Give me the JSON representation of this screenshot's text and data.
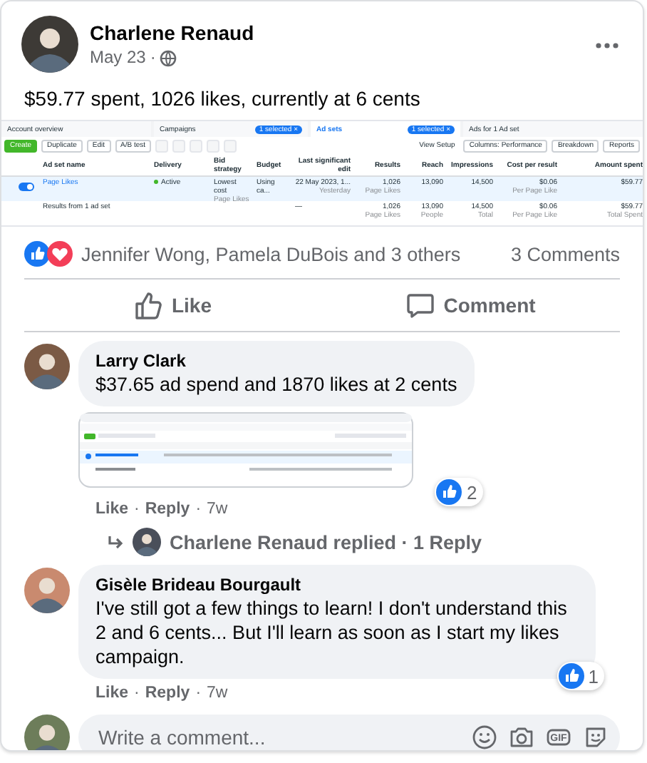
{
  "post": {
    "author": "Charlene Renaud",
    "date": "May 23",
    "separator": "·",
    "text": "$59.77 spent, 1026 likes, currently at 6 cents"
  },
  "ads_screenshot": {
    "tabs": [
      {
        "label": "Account overview",
        "selected": false
      },
      {
        "label": "Campaigns",
        "selected": false,
        "badge": "1 selected ×"
      },
      {
        "label": "Ad sets",
        "selected": true,
        "badge": "1 selected ×"
      },
      {
        "label": "Ads for 1 Ad set",
        "selected": false
      }
    ],
    "toolbar_left": [
      "Create",
      "Duplicate",
      "Edit",
      "A/B test"
    ],
    "toolbar_right": [
      "View Setup",
      "Columns: Performance",
      "Breakdown",
      "Reports"
    ],
    "columns": [
      "Ad set name",
      "Delivery",
      "Bid strategy",
      "Budget",
      "Last significant edit",
      "Results",
      "Reach",
      "Impressions",
      "Cost per result",
      "Amount spent"
    ],
    "rows": [
      {
        "on": true,
        "cells": [
          {
            "text": "Page Likes"
          },
          {
            "text": "Active"
          },
          {
            "text": "Lowest cost",
            "sub": "Page Likes"
          },
          {
            "text": "Using ca..."
          },
          {
            "text": "22 May 2023, 1...",
            "sub": "Yesterday"
          },
          {
            "text": "1,026",
            "sub": "Page Likes"
          },
          {
            "text": "13,090"
          },
          {
            "text": "14,500"
          },
          {
            "text": "$0.06",
            "sub": "Per Page Like"
          },
          {
            "text": "$59.77"
          }
        ]
      }
    ],
    "summary": {
      "label": "Results from 1 ad set",
      "cells": [
        {
          "text": "—"
        },
        {
          "text": "1,026",
          "sub": "Page Likes"
        },
        {
          "text": "13,090",
          "sub": "People"
        },
        {
          "text": "14,500",
          "sub": "Total"
        },
        {
          "text": "$0.06",
          "sub": "Per Page Like"
        },
        {
          "text": "$59.77",
          "sub": "Total Spent"
        }
      ]
    }
  },
  "reactions": {
    "names": "Jennifer Wong, Pamela DuBois and 3 others",
    "comments": "3 Comments"
  },
  "actions": [
    "Like",
    "Comment"
  ],
  "comments": [
    {
      "author": "Larry Clark",
      "text": "$37.65 ad spend and 1870 likes at 2 cents",
      "attachment": {
        "kind": "screenshot"
      },
      "likes": "2",
      "links": [
        "Like",
        "Reply"
      ],
      "time": "7w",
      "replies": "Charlene Renaud replied · 1 Reply"
    },
    {
      "author": "Gisèle Brideau Bourgault",
      "text": "I've still got a few things to learn! I don't understand this 2 and 6 cents... But I'll learn as soon as I start my likes campaign.",
      "likes": "1",
      "links": [
        "Like",
        "Reply"
      ],
      "time": "7w"
    }
  ],
  "composer": {
    "placeholder": "Write a comment...",
    "gif": "GIF"
  }
}
